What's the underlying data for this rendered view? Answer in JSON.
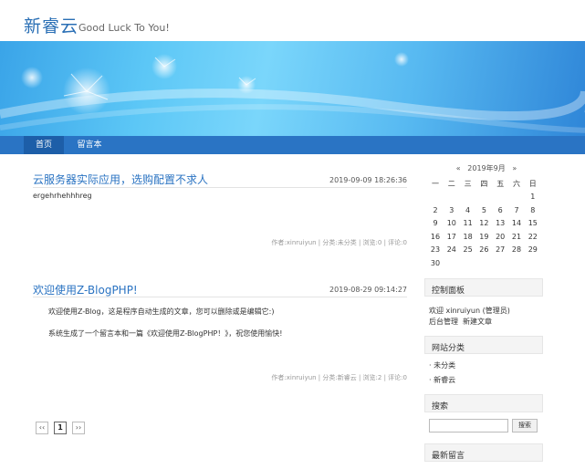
{
  "site": {
    "title": "新睿云",
    "subtitle": "Good Luck To You!"
  },
  "nav": {
    "items": [
      {
        "label": "首页",
        "active": true
      },
      {
        "label": "留言本",
        "active": false
      }
    ]
  },
  "posts": [
    {
      "title": "云服务器实际应用，选购配置不求人",
      "date": "2019-09-09 18:26:36",
      "body": [
        "ergehrhehhhreg"
      ],
      "meta": "作者:xinruiyun | 分类:未分类 | 浏览:0 | 评论:0"
    },
    {
      "title": "欢迎使用Z-BlogPHP!",
      "date": "2019-08-29 09:14:27",
      "body": [
        "欢迎使用Z-Blog，这是程序自动生成的文章，您可以删除或是编辑它:)",
        "系统生成了一个留言本和一篇《欢迎使用Z-BlogPHP！》，祝您使用愉快!"
      ],
      "meta": "作者:xinruiyun | 分类:新睿云 | 浏览:2 | 评论:0"
    }
  ],
  "pagination": {
    "prev": "‹‹",
    "current": "1",
    "next": "››"
  },
  "calendar": {
    "prev": "«",
    "month": "2019年9月",
    "next": "»",
    "weekdays": [
      "一",
      "二",
      "三",
      "四",
      "五",
      "六",
      "日"
    ],
    "rows": [
      [
        "",
        "",
        "",
        "",
        "",
        "",
        "1"
      ],
      [
        "2",
        "3",
        "4",
        "5",
        "6",
        "7",
        "8"
      ],
      [
        "9",
        "10",
        "11",
        "12",
        "13",
        "14",
        "15"
      ],
      [
        "16",
        "17",
        "18",
        "19",
        "20",
        "21",
        "22"
      ],
      [
        "23",
        "24",
        "25",
        "26",
        "27",
        "28",
        "29"
      ],
      [
        "30",
        "",
        "",
        "",
        "",
        "",
        ""
      ]
    ]
  },
  "control_panel": {
    "title": "控制面板",
    "welcome": "欢迎 xinruiyun (管理员)",
    "links": [
      "后台管理",
      "新建文章"
    ]
  },
  "categories": {
    "title": "网站分类",
    "items": [
      "未分类",
      "新睿云"
    ]
  },
  "search": {
    "title": "搜索",
    "button": "搜索",
    "value": ""
  },
  "latest_comments": {
    "title": "最新留言"
  }
}
